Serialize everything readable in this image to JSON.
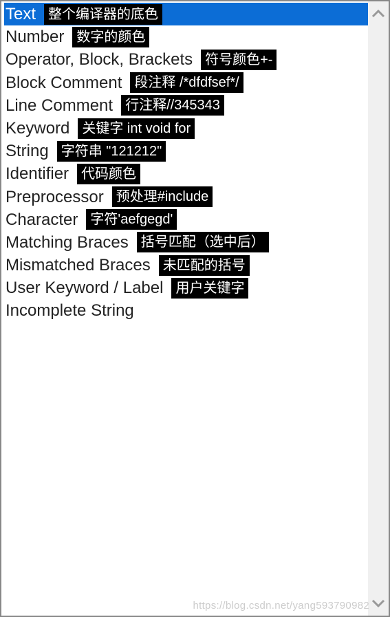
{
  "list": {
    "items": [
      {
        "label": "Text",
        "annotation": "整个编译器的底色",
        "selected": true
      },
      {
        "label": "Number",
        "annotation": "数字的颜色",
        "selected": false
      },
      {
        "label": "Operator, Block, Brackets",
        "annotation": "符号颜色+-",
        "selected": false
      },
      {
        "label": "Block Comment",
        "annotation": "段注释 /*dfdfsef*/",
        "selected": false
      },
      {
        "label": "Line Comment",
        "annotation": "行注释//345343",
        "selected": false
      },
      {
        "label": "Keyword",
        "annotation": "关键字 int void for",
        "selected": false
      },
      {
        "label": "String",
        "annotation": "字符串 \"121212\"",
        "selected": false
      },
      {
        "label": "Identifier",
        "annotation": "代码颜色",
        "selected": false
      },
      {
        "label": "Preprocessor",
        "annotation": "预处理#include",
        "selected": false
      },
      {
        "label": "Character",
        "annotation": "字符'aefgegd'",
        "selected": false
      },
      {
        "label": "Matching Braces",
        "annotation": "括号匹配（选中后）",
        "selected": false
      },
      {
        "label": "Mismatched Braces",
        "annotation": "未匹配的括号",
        "selected": false
      },
      {
        "label": "User Keyword / Label",
        "annotation": "用户关键字",
        "selected": false
      },
      {
        "label": "Incomplete String",
        "annotation": "",
        "selected": false
      }
    ]
  },
  "colors": {
    "selected_bg": "#0c6dd6",
    "annotation_bg": "#000000",
    "annotation_fg": "#ffffff"
  },
  "watermark": "https://blog.csdn.net/yang593790982"
}
